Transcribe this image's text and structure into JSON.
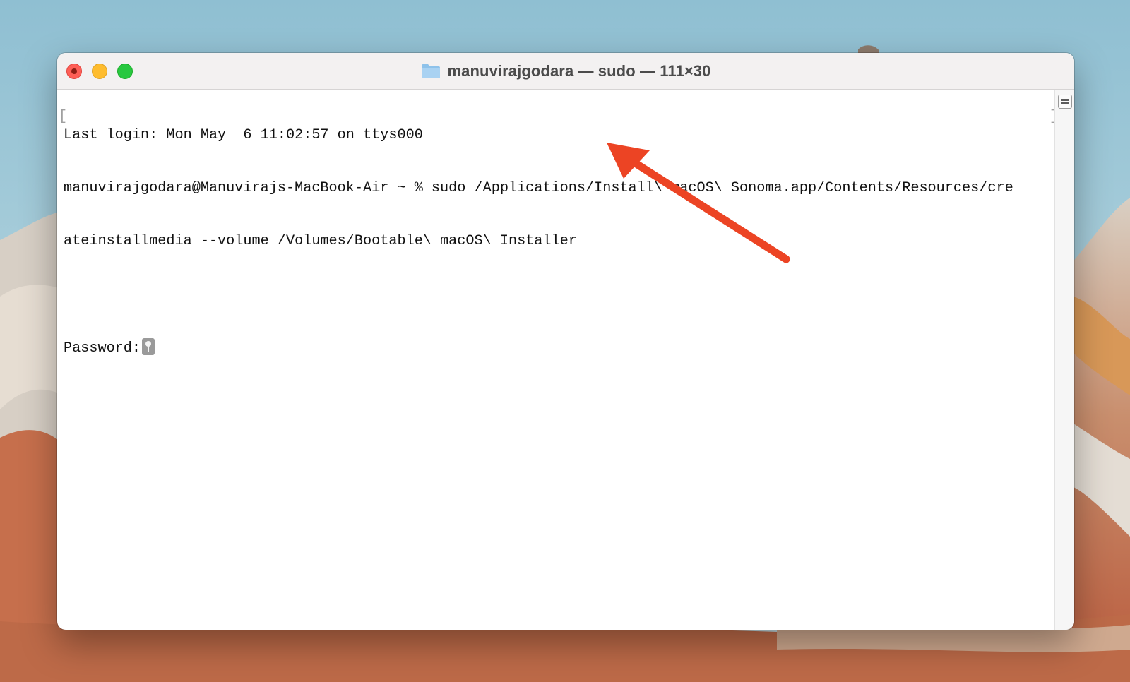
{
  "window": {
    "title": "manuvirajgodara — sudo — 111×30"
  },
  "terminal": {
    "lines": [
      "Last login: Mon May  6 11:02:57 on ttys000",
      "manuvirajgodara@Manuvirajs-MacBook-Air ~ % sudo /Applications/Install\\ macOS\\ Sonoma.app/Contents/Resources/cre",
      "ateinstallmedia --volume /Volumes/Bootable\\ macOS\\ Installer",
      "",
      "Password:"
    ]
  },
  "icons": {
    "title_icon": "folder-icon",
    "cursor_icon": "key-icon",
    "split_icon": "split-view-icon",
    "annotation": "arrow-annotation"
  },
  "colors": {
    "close": "#fe5f57",
    "minimize": "#febc2e",
    "zoom": "#28c840",
    "arrow": "#ec4424"
  }
}
